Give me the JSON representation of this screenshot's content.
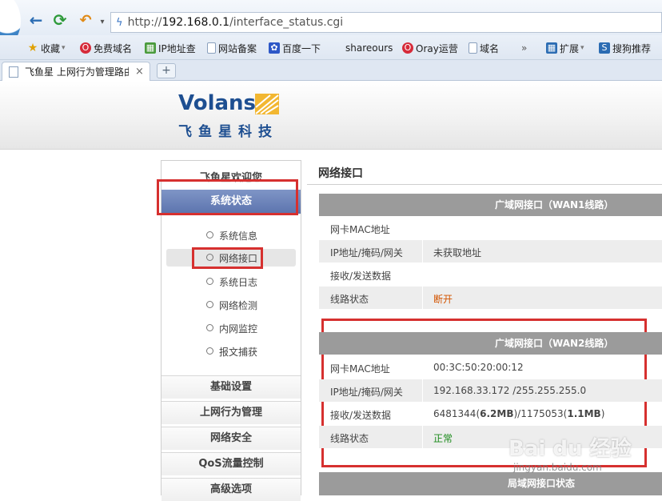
{
  "browser": {
    "url_prefix": "http://",
    "url_host": "192.168.0.1",
    "url_path": "/interface_status.cgi",
    "tab_title": "飞鱼星 上网行为管理路由",
    "tab_close": "×",
    "new_tab": "+",
    "bookmarks": [
      "收藏",
      "免费域名",
      "IP地址查",
      "网站备案",
      "百度一下",
      "shareours",
      "Oray运营",
      "域名",
      "»",
      "扩展",
      "搜狗推荐"
    ]
  },
  "brand": {
    "name_en": "Volans",
    "name_cn": "飞鱼星科技"
  },
  "sidebar": {
    "welcome": "飞鱼星欢迎您",
    "active": "系统状态",
    "items": [
      "系统信息",
      "网络接口",
      "系统日志",
      "网络检测",
      "内网监控",
      "报文捕获"
    ],
    "categories": [
      "基础设置",
      "上网行为管理",
      "网络安全",
      "QoS流量控制",
      "高级选项"
    ]
  },
  "content": {
    "title": "网络接口",
    "wan1": {
      "header": "广域网接口（WAN1线路）",
      "rows": [
        {
          "k": "网卡MAC地址",
          "v": ""
        },
        {
          "k": "IP地址/掩码/网关",
          "v": "未获取地址"
        },
        {
          "k": "接收/发送数据",
          "v": ""
        },
        {
          "k": "线路状态",
          "v": "断开"
        }
      ]
    },
    "wan2": {
      "header": "广域网接口（WAN2线路）",
      "rows": [
        {
          "k": "网卡MAC地址",
          "v": "00:3C:50:20:00:12"
        },
        {
          "k": "IP地址/掩码/网关",
          "v": "192.168.33.172 /255.255.255.0"
        },
        {
          "k": "接收/发送数据",
          "v_a": "6481344(",
          "v_b": "6.2MB",
          "v_c": ")/1175053(",
          "v_d": "1.1MB",
          "v_e": ")"
        },
        {
          "k": "线路状态",
          "v": "正常"
        }
      ]
    },
    "lan_header": "局域网接口状态"
  },
  "watermark": {
    "text": "Bai du 经验",
    "sub": "jingyan.baidu.com"
  },
  "colors": {
    "accent": "#5c74ae",
    "highlight": "#d6302f",
    "ok": "#1a8a1a",
    "down": "#d35400"
  }
}
